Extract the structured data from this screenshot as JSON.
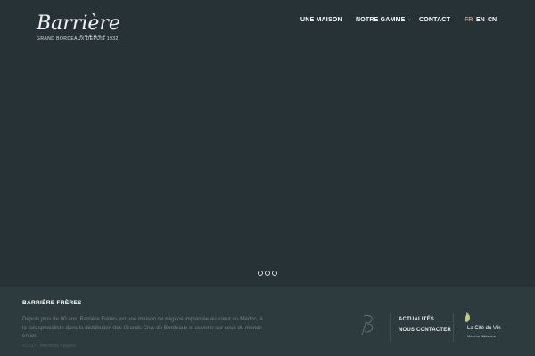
{
  "header": {
    "logo_text": "Barrière",
    "logo_freres": "FRÈRES",
    "logo_tagline": "GRAND BORDEAUX DEPUIS 1932",
    "nav": [
      {
        "label": "UNE MAISON",
        "has_dropdown": false
      },
      {
        "label": "NOTRE GAMME",
        "has_dropdown": true
      },
      {
        "label": "CONTACT",
        "has_dropdown": false
      }
    ],
    "nav_caret": "⌄",
    "languages": [
      {
        "label": "FR",
        "active": true
      },
      {
        "label": "EN",
        "active": false
      },
      {
        "label": "CN",
        "active": false
      }
    ]
  },
  "slider": {
    "dot_count": 3
  },
  "footer": {
    "title": "BARRIÈRE FRÈRES",
    "description": "Depuis plus de 80 ans, Barrière Frères est une maison de négoce implantée au cœur du Médoc, à la fois spécialiste dans la distribution des Grands Crus de Bordeaux et ouverte sur ceux du monde entier.",
    "copyright": "©2017 - Mentions Légales",
    "links": [
      "ACTUALITÉS",
      "NOUS CONTACTER"
    ],
    "partner_name": "La Cité du Vin",
    "partner_sub": "Mécène Bâtisseur"
  },
  "colors": {
    "background": "#263236",
    "footer_background": "#2d3b3e",
    "active_language": "#c79a6e",
    "muted_text": "#6f8289"
  }
}
